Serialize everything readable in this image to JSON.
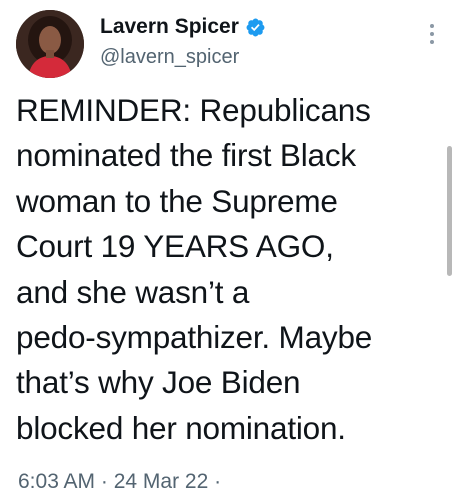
{
  "author": {
    "display_name": "Lavern Spicer",
    "handle": "@lavern_spicer",
    "verified": true,
    "avatar_icon": "profile-photo",
    "verified_color": "#1d9bf0"
  },
  "tweet": {
    "lines": [
      "REMINDER: Republicans",
      "nominated the first Black",
      "woman to the Supreme",
      "Court 19 YEARS AGO,",
      "and she wasn’t a",
      "pedo-sympathizer. Maybe",
      "that’s why Joe Biden",
      "blocked her nomination."
    ],
    "timestamp": "6:03 AM · 24 Mar 22 ·"
  },
  "icons": {
    "more": "more-options-icon",
    "verified": "verified-badge-icon"
  },
  "colors": {
    "text": "#0f1419",
    "secondary": "#536471"
  }
}
